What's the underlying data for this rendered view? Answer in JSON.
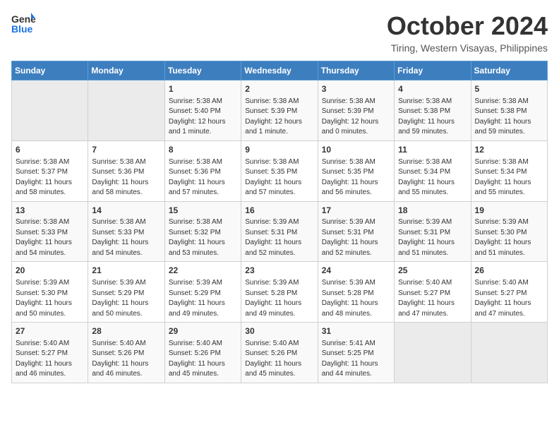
{
  "header": {
    "logo_line1": "General",
    "logo_line2": "Blue",
    "month": "October 2024",
    "location": "Tiring, Western Visayas, Philippines"
  },
  "weekdays": [
    "Sunday",
    "Monday",
    "Tuesday",
    "Wednesday",
    "Thursday",
    "Friday",
    "Saturday"
  ],
  "weeks": [
    [
      {
        "day": "",
        "info": ""
      },
      {
        "day": "",
        "info": ""
      },
      {
        "day": "1",
        "info": "Sunrise: 5:38 AM\nSunset: 5:40 PM\nDaylight: 12 hours\nand 1 minute."
      },
      {
        "day": "2",
        "info": "Sunrise: 5:38 AM\nSunset: 5:39 PM\nDaylight: 12 hours\nand 1 minute."
      },
      {
        "day": "3",
        "info": "Sunrise: 5:38 AM\nSunset: 5:39 PM\nDaylight: 12 hours\nand 0 minutes."
      },
      {
        "day": "4",
        "info": "Sunrise: 5:38 AM\nSunset: 5:38 PM\nDaylight: 11 hours\nand 59 minutes."
      },
      {
        "day": "5",
        "info": "Sunrise: 5:38 AM\nSunset: 5:38 PM\nDaylight: 11 hours\nand 59 minutes."
      }
    ],
    [
      {
        "day": "6",
        "info": "Sunrise: 5:38 AM\nSunset: 5:37 PM\nDaylight: 11 hours\nand 58 minutes."
      },
      {
        "day": "7",
        "info": "Sunrise: 5:38 AM\nSunset: 5:36 PM\nDaylight: 11 hours\nand 58 minutes."
      },
      {
        "day": "8",
        "info": "Sunrise: 5:38 AM\nSunset: 5:36 PM\nDaylight: 11 hours\nand 57 minutes."
      },
      {
        "day": "9",
        "info": "Sunrise: 5:38 AM\nSunset: 5:35 PM\nDaylight: 11 hours\nand 57 minutes."
      },
      {
        "day": "10",
        "info": "Sunrise: 5:38 AM\nSunset: 5:35 PM\nDaylight: 11 hours\nand 56 minutes."
      },
      {
        "day": "11",
        "info": "Sunrise: 5:38 AM\nSunset: 5:34 PM\nDaylight: 11 hours\nand 55 minutes."
      },
      {
        "day": "12",
        "info": "Sunrise: 5:38 AM\nSunset: 5:34 PM\nDaylight: 11 hours\nand 55 minutes."
      }
    ],
    [
      {
        "day": "13",
        "info": "Sunrise: 5:38 AM\nSunset: 5:33 PM\nDaylight: 11 hours\nand 54 minutes."
      },
      {
        "day": "14",
        "info": "Sunrise: 5:38 AM\nSunset: 5:33 PM\nDaylight: 11 hours\nand 54 minutes."
      },
      {
        "day": "15",
        "info": "Sunrise: 5:38 AM\nSunset: 5:32 PM\nDaylight: 11 hours\nand 53 minutes."
      },
      {
        "day": "16",
        "info": "Sunrise: 5:39 AM\nSunset: 5:31 PM\nDaylight: 11 hours\nand 52 minutes."
      },
      {
        "day": "17",
        "info": "Sunrise: 5:39 AM\nSunset: 5:31 PM\nDaylight: 11 hours\nand 52 minutes."
      },
      {
        "day": "18",
        "info": "Sunrise: 5:39 AM\nSunset: 5:31 PM\nDaylight: 11 hours\nand 51 minutes."
      },
      {
        "day": "19",
        "info": "Sunrise: 5:39 AM\nSunset: 5:30 PM\nDaylight: 11 hours\nand 51 minutes."
      }
    ],
    [
      {
        "day": "20",
        "info": "Sunrise: 5:39 AM\nSunset: 5:30 PM\nDaylight: 11 hours\nand 50 minutes."
      },
      {
        "day": "21",
        "info": "Sunrise: 5:39 AM\nSunset: 5:29 PM\nDaylight: 11 hours\nand 50 minutes."
      },
      {
        "day": "22",
        "info": "Sunrise: 5:39 AM\nSunset: 5:29 PM\nDaylight: 11 hours\nand 49 minutes."
      },
      {
        "day": "23",
        "info": "Sunrise: 5:39 AM\nSunset: 5:28 PM\nDaylight: 11 hours\nand 49 minutes."
      },
      {
        "day": "24",
        "info": "Sunrise: 5:39 AM\nSunset: 5:28 PM\nDaylight: 11 hours\nand 48 minutes."
      },
      {
        "day": "25",
        "info": "Sunrise: 5:40 AM\nSunset: 5:27 PM\nDaylight: 11 hours\nand 47 minutes."
      },
      {
        "day": "26",
        "info": "Sunrise: 5:40 AM\nSunset: 5:27 PM\nDaylight: 11 hours\nand 47 minutes."
      }
    ],
    [
      {
        "day": "27",
        "info": "Sunrise: 5:40 AM\nSunset: 5:27 PM\nDaylight: 11 hours\nand 46 minutes."
      },
      {
        "day": "28",
        "info": "Sunrise: 5:40 AM\nSunset: 5:26 PM\nDaylight: 11 hours\nand 46 minutes."
      },
      {
        "day": "29",
        "info": "Sunrise: 5:40 AM\nSunset: 5:26 PM\nDaylight: 11 hours\nand 45 minutes."
      },
      {
        "day": "30",
        "info": "Sunrise: 5:40 AM\nSunset: 5:26 PM\nDaylight: 11 hours\nand 45 minutes."
      },
      {
        "day": "31",
        "info": "Sunrise: 5:41 AM\nSunset: 5:25 PM\nDaylight: 11 hours\nand 44 minutes."
      },
      {
        "day": "",
        "info": ""
      },
      {
        "day": "",
        "info": ""
      }
    ]
  ]
}
